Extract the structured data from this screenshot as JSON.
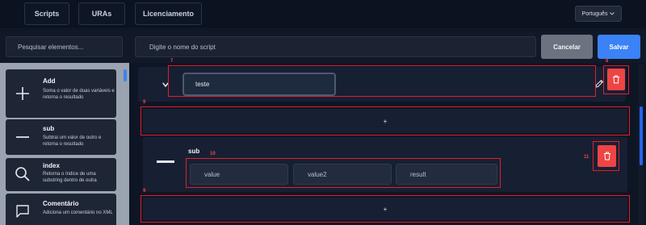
{
  "nav": {
    "items": [
      "Scripts",
      "URAs",
      "Licenciamento"
    ],
    "language": "Português"
  },
  "toolbar": {
    "search_placeholder": "Pesquisar elementos...",
    "script_name_placeholder": "Digite o nome do script",
    "cancel_label": "Cancelar",
    "save_label": "Salvar"
  },
  "sidebar": {
    "items": [
      {
        "icon": "plus-icon",
        "title": "Add",
        "description": "Soma o valor de duas variáveis e retorna o resultado"
      },
      {
        "icon": "minus-icon",
        "title": "sub",
        "description": "Subtrai um valor de outro e retorna o resultado"
      },
      {
        "icon": "search-icon",
        "title": "index",
        "description": "Retorna o índice de uma substring dentro de outra"
      },
      {
        "icon": "comment-icon",
        "title": "Comentário",
        "description": "Adiciona um comentário no XML"
      }
    ]
  },
  "canvas": {
    "block_name_value": "teste",
    "add_label": "+",
    "sub_block": {
      "title": "sub",
      "fields": [
        "value",
        "value2",
        "result"
      ]
    },
    "annotations": {
      "name_box": "7",
      "delete_box": "8",
      "add_box": "9",
      "fields_box": "10",
      "sub_delete_box": "11"
    }
  },
  "colors": {
    "accent": "#3b82f6",
    "danger": "#ef4444",
    "annotation": "#e11d2e"
  }
}
